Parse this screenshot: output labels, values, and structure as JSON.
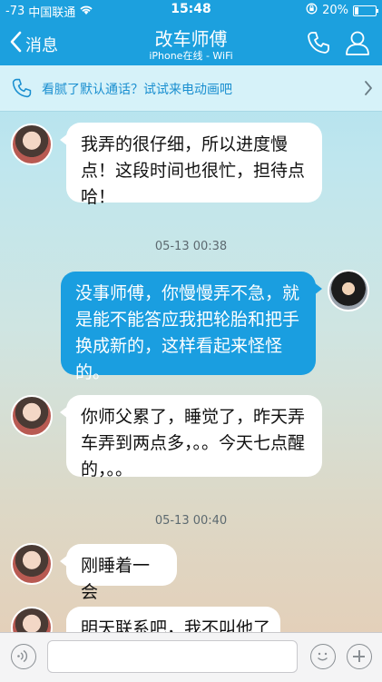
{
  "status_bar": {
    "signal": "-73",
    "carrier": "中国联通",
    "time": "15:48",
    "battery_percent": "20%",
    "battery_level": 0.2
  },
  "header": {
    "back_label": "消息",
    "title": "改车师傅",
    "subtitle": "iPhone在线 - WiFi"
  },
  "banner": {
    "text": "看腻了默认通话？试试来电动画吧"
  },
  "messages": [
    {
      "text": "我弄的很仔细，所以进度慢点！这段时间也很忙，担待点哈！"
    },
    {
      "text": "没事师傅，你慢慢弄不急，就是能不能答应我把轮胎和把手换成新的，这样看起来怪怪的。"
    },
    {
      "text": "你师父累了，睡觉了，昨天弄车弄到两点多，。。今天七点醒的，。。"
    },
    {
      "text": "刚睡着一会"
    },
    {
      "text": "明天联系吧，我不叫他了"
    }
  ],
  "timestamps": [
    "05-13 00:38",
    "05-13 00:40"
  ],
  "input": {
    "value": ""
  },
  "colors": {
    "header": "#1ca0de",
    "outgoing_bubble": "#1a9ee0",
    "incoming_bubble": "#ffffff"
  },
  "icons": [
    "wifi-icon",
    "chevron-left-icon",
    "phone-icon",
    "profile-icon",
    "banner-phone-icon",
    "chevron-right-icon",
    "voice-icon",
    "emoji-icon",
    "plus-icon"
  ]
}
